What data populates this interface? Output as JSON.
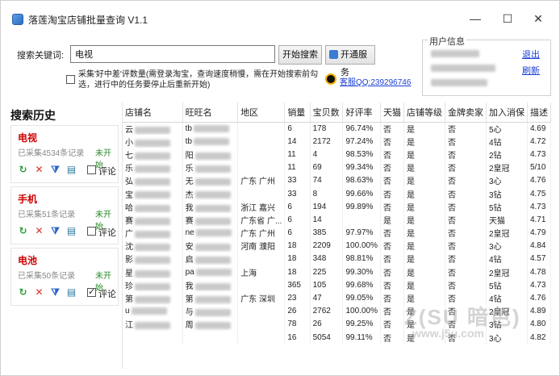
{
  "window": {
    "title": "落莲淘宝店铺批量查询 V1.1",
    "controls": {
      "minimize": "—",
      "maximize": "☐",
      "close": "✕"
    }
  },
  "search": {
    "label": "搜索关键词:",
    "value": "电视",
    "start_button": "开始搜索",
    "service_button": "开通服务",
    "option_label": "采集'好中差'评数量(需登录淘宝，查询速度稍慢，需在开始搜索前勾选，进行中的任务要停止后重新开始)",
    "qq_label": "客服QQ:239296746"
  },
  "user": {
    "box_title": "用户信息",
    "logout": "退出",
    "refresh": "刷新"
  },
  "history": {
    "title": "搜索历史",
    "items": [
      {
        "name": "电视",
        "count": "已采集4534条记录",
        "status": "未开始",
        "review_label": "评论",
        "review_checked": false
      },
      {
        "name": "手机",
        "count": "已采集51条记录",
        "status": "未开始",
        "review_label": "评论",
        "review_checked": false
      },
      {
        "name": "电池",
        "count": "已采集50条记录",
        "status": "未开始",
        "review_label": "评论",
        "review_checked": true
      }
    ]
  },
  "table": {
    "columns": [
      "店铺名",
      "旺旺名",
      "地区",
      "销量",
      "宝贝数",
      "好评率",
      "天猫",
      "店铺等级",
      "金牌卖家",
      "加入消保",
      "描述"
    ],
    "rows": [
      [
        "云",
        "tb",
        "",
        "6",
        "178",
        "96.74%",
        "否",
        "是",
        "否",
        "5心",
        "4.69"
      ],
      [
        "小",
        "tb",
        "",
        "14",
        "2172",
        "97.24%",
        "否",
        "是",
        "否",
        "4钻",
        "4.72"
      ],
      [
        "七",
        "阳",
        "",
        "11",
        "4",
        "98.53%",
        "否",
        "是",
        "否",
        "2钻",
        "4.73"
      ],
      [
        "乐",
        "乐",
        "",
        "11",
        "69",
        "99.34%",
        "否",
        "是",
        "否",
        "2皇冠",
        "5/10"
      ],
      [
        "弘",
        "无",
        "广东 广州",
        "33",
        "74",
        "98.63%",
        "否",
        "是",
        "否",
        "3心",
        "4.76"
      ],
      [
        "宝",
        "杰",
        "",
        "33",
        "8",
        "99.66%",
        "否",
        "是",
        "否",
        "3钻",
        "4.75"
      ],
      [
        "哈",
        "我",
        "浙江 嘉兴",
        "6",
        "194",
        "99.89%",
        "否",
        "是",
        "否",
        "5钻",
        "4.73"
      ],
      [
        "赛",
        "赛",
        "广东省 广...",
        "6",
        "14",
        "",
        "是",
        "是",
        "否",
        "天猫",
        "4.71"
      ],
      [
        "广",
        "ne",
        "广东 广州",
        "6",
        "385",
        "97.97%",
        "否",
        "是",
        "否",
        "2皇冠",
        "4.79"
      ],
      [
        "沈",
        "安",
        "河南 濮阳",
        "18",
        "2209",
        "100.00%",
        "否",
        "是",
        "否",
        "3心",
        "4.84"
      ],
      [
        "影",
        "启",
        "",
        "18",
        "348",
        "98.81%",
        "否",
        "是",
        "否",
        "4钻",
        "4.57"
      ],
      [
        "星",
        "pa",
        "上海",
        "18",
        "225",
        "99.30%",
        "否",
        "是",
        "否",
        "2皇冠",
        "4.78"
      ],
      [
        "珍",
        "我",
        "",
        "365",
        "105",
        "99.68%",
        "否",
        "是",
        "否",
        "5钻",
        "4.73"
      ],
      [
        "第",
        "第",
        "广东 深圳",
        "23",
        "47",
        "99.05%",
        "否",
        "是",
        "否",
        "4钻",
        "4.76"
      ],
      [
        "u",
        "与",
        "",
        "26",
        "2762",
        "100.00%",
        "否",
        "是",
        "否",
        "2皇冠",
        "4.89"
      ],
      [
        "江",
        "周",
        "",
        "78",
        "26",
        "99.25%",
        "否",
        "是",
        "否",
        "3钻",
        "4.80"
      ],
      [
        "",
        "",
        "",
        "16",
        "5054",
        "99.11%",
        "否",
        "是",
        "否",
        "3心",
        "4.82"
      ]
    ]
  },
  "watermark": {
    "line1": "Z(SU 暗色)",
    "line2": "www.j5u.com"
  }
}
